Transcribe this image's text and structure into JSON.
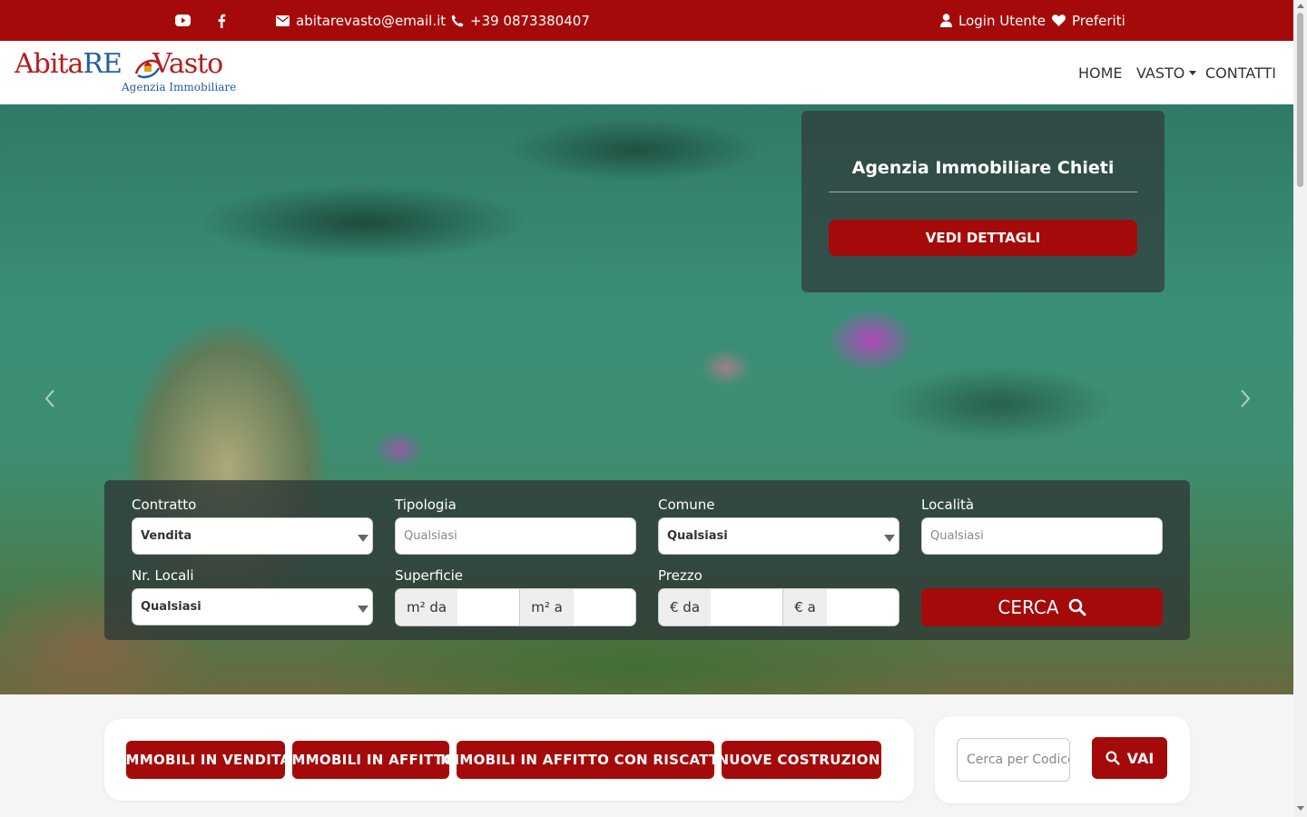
{
  "colors": {
    "brand_red": "#a50a0a",
    "logo_blue": "#1f5fa8"
  },
  "topbar": {
    "youtube_icon": "youtube-icon",
    "facebook_icon": "facebook-icon",
    "email": "abitarevasto@email.it",
    "phone": "+39 0873380407",
    "login": "Login Utente",
    "favorites": "Preferiti"
  },
  "logo": {
    "part1": "Abita",
    "part2": "RE",
    "part3": "Vasto",
    "subtitle": "Agenzia Immobiliare"
  },
  "nav": {
    "home": "HOME",
    "vasto": "VASTO",
    "contatti": "CONTATTI"
  },
  "promo": {
    "title": "Agenzia Immobiliare Chieti",
    "button": "VEDI DETTAGLI"
  },
  "search": {
    "contratto_label": "Contratto",
    "contratto_value": "Vendita",
    "tipologia_label": "Tipologia",
    "tipologia_placeholder": "Qualsiasi",
    "comune_label": "Comune",
    "comune_value": "Qualsiasi",
    "localita_label": "Località",
    "localita_placeholder": "Qualsiasi",
    "locali_label": "Nr. Locali",
    "locali_value": "Qualsiasi",
    "superficie_label": "Superficie",
    "superficie_from": "m² da",
    "superficie_to": "m² a",
    "prezzo_label": "Prezzo",
    "prezzo_from": "€ da",
    "prezzo_to": "€ a",
    "cerca": "CERCA"
  },
  "quick_links": {
    "vendita": "IMMOBILI IN VENDITA",
    "affitto": "IMMOBILI IN AFFITTO",
    "riscatto": "IMMOBILI IN AFFITTO CON RISCATTO",
    "nuove": "NUOVE COSTRUZIONI"
  },
  "code_search": {
    "placeholder": "Cerca per Codice",
    "button": "VAI"
  }
}
